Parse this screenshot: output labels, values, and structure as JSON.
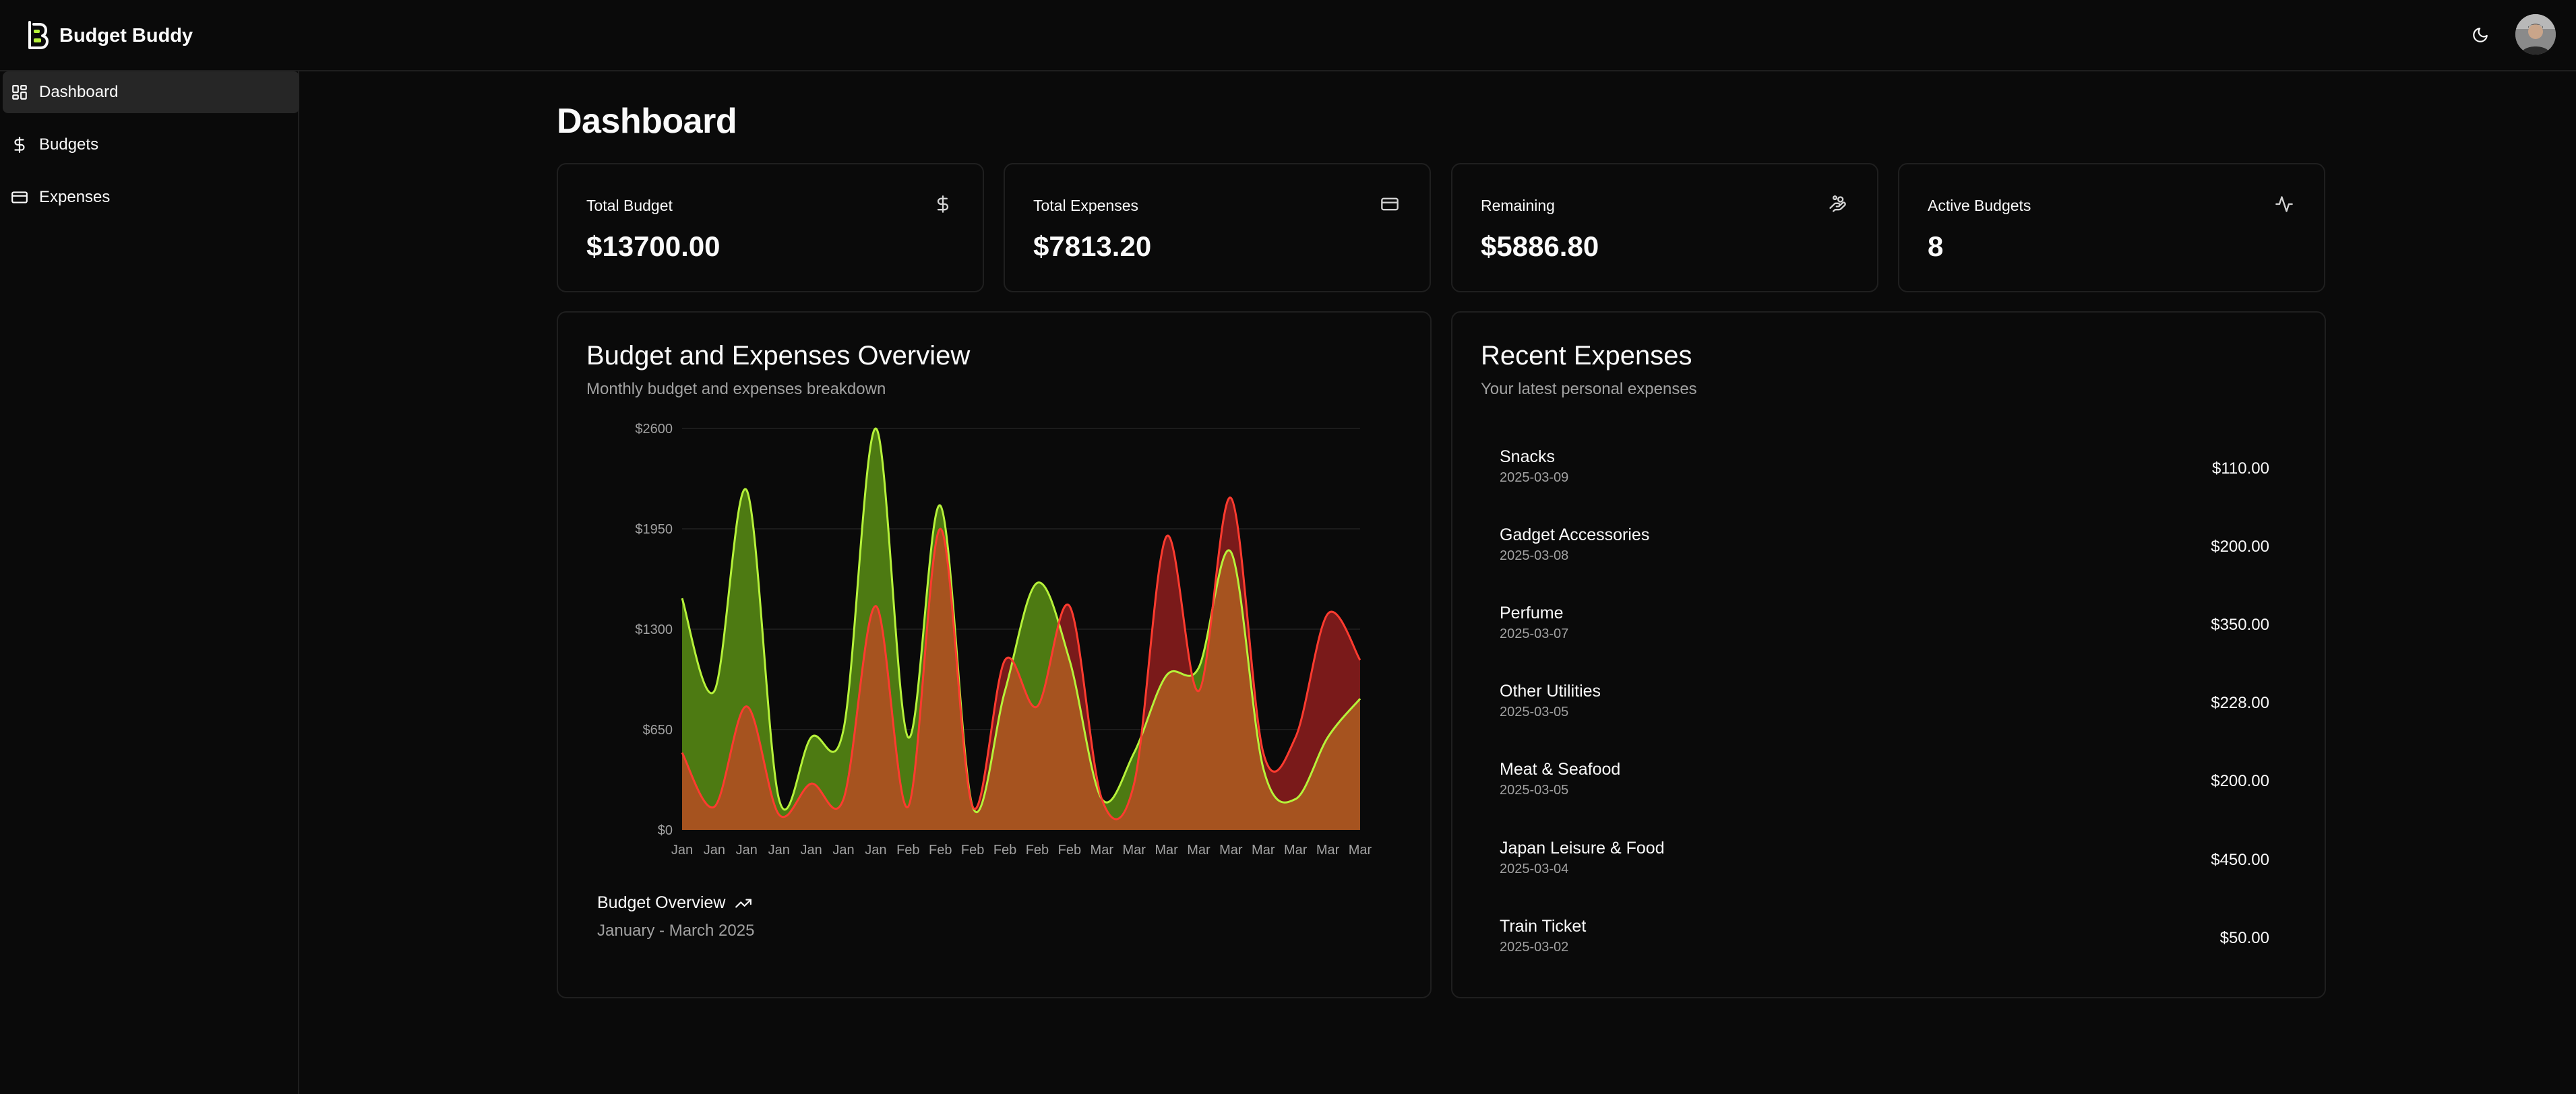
{
  "app": {
    "name": "Budget Buddy"
  },
  "sidebar": {
    "items": [
      {
        "label": "Dashboard",
        "icon": "dashboard-grid-icon",
        "active": true
      },
      {
        "label": "Budgets",
        "icon": "dollar-icon",
        "active": false
      },
      {
        "label": "Expenses",
        "icon": "credit-card-icon",
        "active": false
      }
    ]
  },
  "page": {
    "title": "Dashboard"
  },
  "stats": [
    {
      "label": "Total Budget",
      "value": "$13700.00",
      "icon": "dollar-icon"
    },
    {
      "label": "Total Expenses",
      "value": "$7813.20",
      "icon": "credit-card-icon"
    },
    {
      "label": "Remaining",
      "value": "$5886.80",
      "icon": "coins-icon"
    },
    {
      "label": "Active Budgets",
      "value": "8",
      "icon": "activity-icon"
    }
  ],
  "overview": {
    "title": "Budget and Expenses Overview",
    "subtitle": "Monthly budget and expenses breakdown",
    "footer_title": "Budget Overview",
    "footer_sub": "January - March 2025"
  },
  "recent": {
    "title": "Recent Expenses",
    "subtitle": "Your latest personal expenses",
    "items": [
      {
        "name": "Snacks",
        "date": "2025-03-09",
        "amount": "$110.00"
      },
      {
        "name": "Gadget Accessories",
        "date": "2025-03-08",
        "amount": "$200.00"
      },
      {
        "name": "Perfume",
        "date": "2025-03-07",
        "amount": "$350.00"
      },
      {
        "name": "Other Utilities",
        "date": "2025-03-05",
        "amount": "$228.00"
      },
      {
        "name": "Meat & Seafood",
        "date": "2025-03-05",
        "amount": "$200.00"
      },
      {
        "name": "Japan Leisure & Food",
        "date": "2025-03-04",
        "amount": "$450.00"
      },
      {
        "name": "Train Ticket",
        "date": "2025-03-02",
        "amount": "$50.00"
      }
    ]
  },
  "colors": {
    "budget_line": "#b6f23a",
    "budget_fill": "#4d7a12",
    "expense_line": "#ff3b2f",
    "expense_fill": "#7a1a1a",
    "overlap_fill": "#a6531f"
  },
  "chart_data": {
    "type": "area",
    "x": [
      "Jan",
      "Jan",
      "Jan",
      "Jan",
      "Jan",
      "Jan",
      "Jan",
      "Feb",
      "Feb",
      "Feb",
      "Feb",
      "Feb",
      "Feb",
      "Mar",
      "Mar",
      "Mar",
      "Mar",
      "Mar",
      "Mar",
      "Mar",
      "Mar",
      "Mar"
    ],
    "ylim": [
      0,
      2600
    ],
    "yticks": [
      "$0",
      "$650",
      "$1300",
      "$1950",
      "$2600"
    ],
    "ytick_values": [
      0,
      650,
      1300,
      1950,
      2600
    ],
    "series": [
      {
        "values": [
          1500,
          900,
          2200,
          200,
          600,
          650,
          2600,
          600,
          2100,
          150,
          900,
          1600,
          1100,
          200,
          500,
          1000,
          1050,
          1800,
          400,
          200,
          600,
          850
        ]
      },
      {
        "values": [
          500,
          150,
          800,
          100,
          300,
          200,
          1450,
          150,
          1950,
          150,
          1100,
          800,
          1450,
          200,
          300,
          1900,
          900,
          2150,
          500,
          600,
          1400,
          1100
        ]
      }
    ],
    "grid": true
  }
}
